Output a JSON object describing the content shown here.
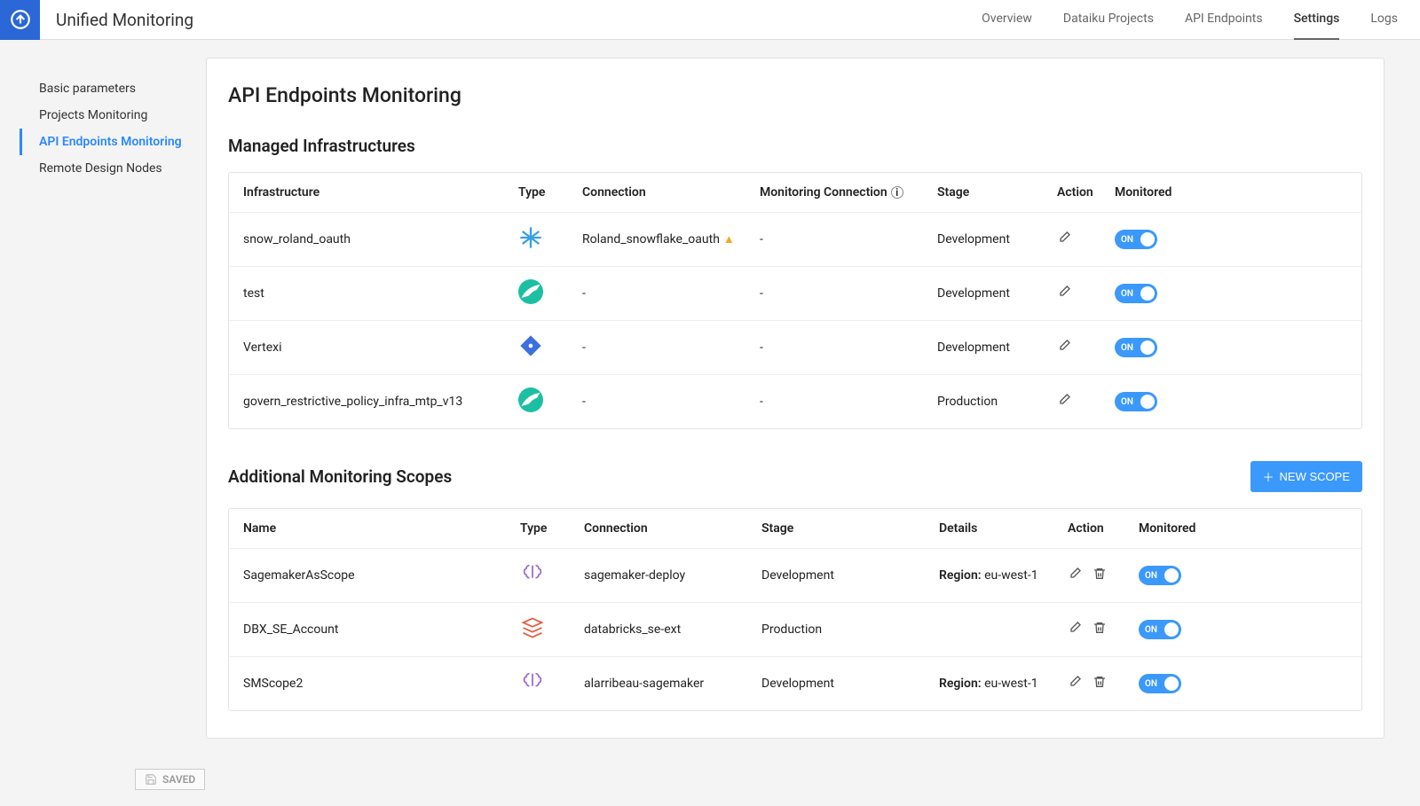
{
  "app_title": "Unified Monitoring",
  "topnav": {
    "overview": "Overview",
    "projects": "Dataiku Projects",
    "api": "API Endpoints",
    "settings": "Settings",
    "logs": "Logs"
  },
  "sidebar": {
    "basic": "Basic parameters",
    "projects": "Projects Monitoring",
    "api": "API Endpoints Monitoring",
    "remote": "Remote Design Nodes"
  },
  "page": {
    "title": "API Endpoints Monitoring",
    "managed_title": "Managed Infrastructures",
    "scopes_title": "Additional Monitoring Scopes",
    "new_scope_btn": "NEW SCOPE"
  },
  "infra_headers": {
    "infra": "Infrastructure",
    "type": "Type",
    "conn": "Connection",
    "monconn": "Monitoring Connection",
    "stage": "Stage",
    "action": "Action",
    "monitored": "Monitored"
  },
  "infra_rows": [
    {
      "name": "snow_roland_oauth",
      "type": "snowflake",
      "conn": "Roland_snowflake_oauth",
      "warn": true,
      "monconn": "-",
      "stage": "Development",
      "on": "ON"
    },
    {
      "name": "test",
      "type": "dataiku",
      "conn": "-",
      "warn": false,
      "monconn": "-",
      "stage": "Development",
      "on": "ON"
    },
    {
      "name": "Vertexi",
      "type": "vertex",
      "conn": "-",
      "warn": false,
      "monconn": "-",
      "stage": "Development",
      "on": "ON"
    },
    {
      "name": "govern_restrictive_policy_infra_mtp_v13",
      "type": "dataiku",
      "conn": "-",
      "warn": false,
      "monconn": "-",
      "stage": "Production",
      "on": "ON"
    }
  ],
  "scope_headers": {
    "name": "Name",
    "type": "Type",
    "conn": "Connection",
    "stage": "Stage",
    "details": "Details",
    "action": "Action",
    "monitored": "Monitored"
  },
  "scope_rows": [
    {
      "name": "SagemakerAsScope",
      "type": "sagemaker",
      "conn": "sagemaker-deploy",
      "stage": "Development",
      "details_label": "Region:",
      "details_value": "eu-west-1",
      "on": "ON"
    },
    {
      "name": "DBX_SE_Account",
      "type": "databricks",
      "conn": "databricks_se-ext",
      "stage": "Production",
      "details_label": "",
      "details_value": "",
      "on": "ON"
    },
    {
      "name": "SMScope2",
      "type": "sagemaker",
      "conn": "alarribeau-sagemaker",
      "stage": "Development",
      "details_label": "Region:",
      "details_value": "eu-west-1",
      "on": "ON"
    }
  ],
  "saved_label": "SAVED"
}
